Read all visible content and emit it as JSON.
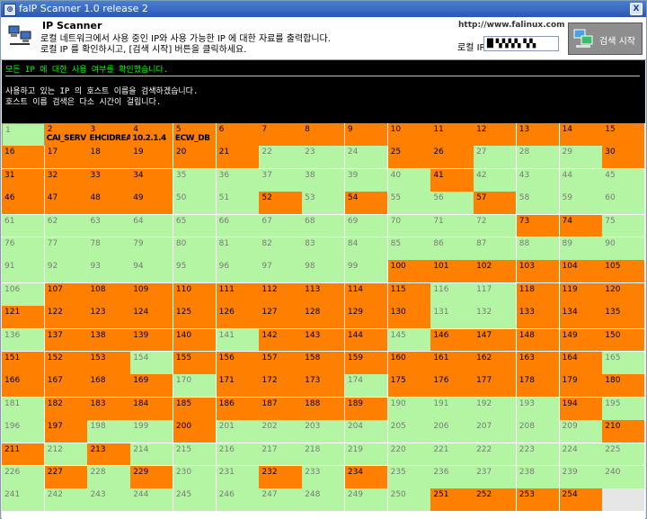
{
  "window": {
    "title": "falP Scanner 1.0 release 2",
    "close_label": "X"
  },
  "header": {
    "title": "IP Scanner",
    "desc_line1": "로컬 네트워크에서 사용 중인 IP와 사용 가능한 IP 에 대한 자료를 출력합니다.",
    "desc_line2": "로컬 IP 를 확인하시고, [검색 시작] 버튼을 클릭하세요.",
    "url": "http://www.falinux.com",
    "ip_label": "로컬 IP",
    "ip_value": "█ ▚▚▚▚ ▚▚",
    "search_label": "검색 시작"
  },
  "console": {
    "line1": "모든 IP 에 대한 사용 여부를 확인했습니다.",
    "line2": "사용하고 있는 IP 의 호스트 이름을 검색하겠습니다.",
    "line3": "호스트 이름 검색은 다소 시간이 걸립니다."
  },
  "grid": {
    "columns": 15,
    "colors": {
      "used": "#ff7f00",
      "free": "#b3f5a2",
      "selected_border": "#8aa878"
    },
    "used": [
      2,
      3,
      4,
      5,
      6,
      7,
      8,
      9,
      10,
      11,
      12,
      13,
      14,
      15,
      16,
      17,
      18,
      19,
      20,
      21,
      25,
      26,
      30,
      31,
      32,
      33,
      34,
      41,
      46,
      47,
      48,
      49,
      52,
      54,
      57,
      73,
      74,
      100,
      101,
      102,
      103,
      104,
      105,
      107,
      108,
      109,
      110,
      111,
      112,
      113,
      114,
      115,
      118,
      119,
      120,
      121,
      122,
      123,
      124,
      125,
      126,
      127,
      128,
      129,
      130,
      133,
      134,
      135,
      137,
      138,
      139,
      140,
      142,
      143,
      144,
      146,
      147,
      148,
      149,
      150,
      151,
      152,
      153,
      155,
      156,
      157,
      158,
      159,
      160,
      161,
      162,
      163,
      164,
      166,
      167,
      168,
      169,
      171,
      172,
      173,
      175,
      176,
      177,
      178,
      179,
      180,
      182,
      183,
      184,
      185,
      186,
      187,
      188,
      189,
      194,
      197,
      200,
      210,
      211,
      213,
      227,
      229,
      232,
      234,
      251,
      252,
      253,
      254
    ],
    "host_labels": {
      "2": "CAI_SERV",
      "3": "EHCIDREA",
      "4": "10.2.1.4",
      "5": "ECW_DB"
    },
    "selected": 1
  }
}
